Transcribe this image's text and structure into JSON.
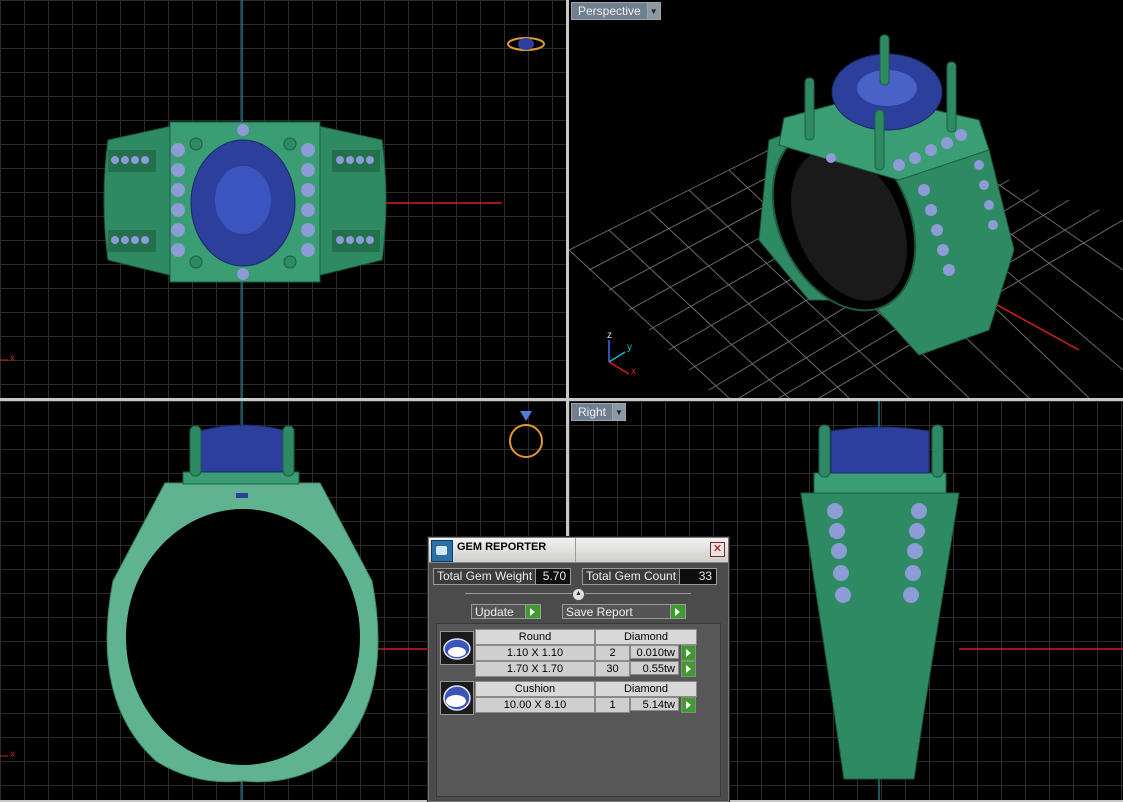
{
  "viewports": {
    "top_right_label": "Perspective",
    "bottom_right_label": "Right",
    "axis_x": "x",
    "axis_y": "y",
    "axis_z": "z"
  },
  "gem_reporter": {
    "title": "GEM REPORTER",
    "total_weight_label": "Total Gem Weight",
    "total_weight_value": "5.70",
    "total_count_label": "Total Gem Count",
    "total_count_value": "33",
    "update_label": "Update",
    "save_report_label": "Save Report",
    "groups": [
      {
        "shape": "Round",
        "material": "Diamond",
        "rows": [
          {
            "size": "1.10 X 1.10",
            "count": "2",
            "weight": "0.010tw"
          },
          {
            "size": "1.70 X 1.70",
            "count": "30",
            "weight": "0.55tw"
          }
        ]
      },
      {
        "shape": "Cushion",
        "material": "Diamond",
        "rows": [
          {
            "size": "10.00 X 8.10",
            "count": "1",
            "weight": "5.14tw"
          }
        ]
      }
    ]
  },
  "colors": {
    "metal": "#2e8a62",
    "metal_light": "#5fb391",
    "gem_blue": "#2c3f9a",
    "accent_stones": "#8d9bd6",
    "grid": "#2c2c2c",
    "axis_red": "#d01f1f",
    "axis_cyan": "#1fb8c4",
    "gizmo_orange": "#e39a2a"
  }
}
